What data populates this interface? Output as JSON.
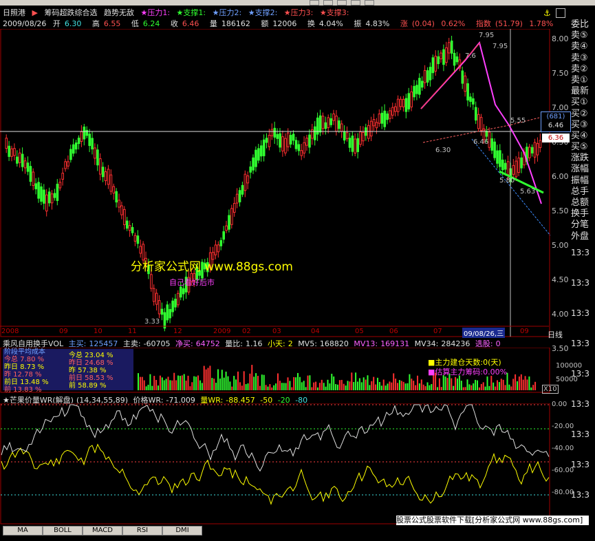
{
  "header": {
    "stock_name": "日照港",
    "menu_items": [
      "筹码超跌综合选",
      "趋势无敌"
    ],
    "indicators": [
      {
        "label": "★压力1:",
        "color": "#ff40ff"
      },
      {
        "label": "★支撑1:",
        "color": "#30ff30"
      },
      {
        "label": "★压力2:",
        "color": "#6fa0ff"
      },
      {
        "label": "★支撑2:",
        "color": "#6fa0ff"
      },
      {
        "label": "★压力3:",
        "color": "#ff5050"
      },
      {
        "label": "★支撑3:",
        "color": "#ff5050"
      }
    ],
    "date": "2009/08/26",
    "open_label": "开",
    "open": "6.30",
    "high_label": "高",
    "high": "6.55",
    "low_label": "低",
    "low": "6.24",
    "close_label": "收",
    "close": "6.46",
    "volume_label": "量",
    "volume": "186162",
    "amount_label": "额",
    "amount": "12006",
    "turnover_label": "换",
    "turnover": "4.04%",
    "amplitude_label": "振",
    "amplitude": "4.83%",
    "change_label": "涨",
    "change": "(0.04)",
    "change_pct": "0.62%",
    "index_label": "指数",
    "index_value": "(51.79)",
    "index_pct": "1.78%"
  },
  "right_panel": {
    "items": [
      "委比",
      "卖⑤",
      "卖④",
      "卖③",
      "卖②",
      "卖①",
      "最新",
      "买①",
      "买②",
      "买③",
      "买④",
      "买⑤",
      "涨跌",
      "涨幅",
      "振幅",
      "总手",
      "总额",
      "换手",
      "分笔",
      "外盘"
    ],
    "time_labels": [
      "13:3",
      "13:3",
      "13:3",
      "13:3",
      "13:3",
      "13:3",
      "13:3",
      "13:3",
      "13:3"
    ]
  },
  "price_axis": [
    "8.00",
    "7.50",
    "7.00",
    "6.50",
    "6.00",
    "5.50",
    "5.00",
    "4.50",
    "4.00",
    "3.50"
  ],
  "price_tags": {
    "bar_count": "(681)",
    "current": "6.46",
    "last": "6.36"
  },
  "chart_annotations": {
    "high_point": "7.95",
    "high_point2": "7.95",
    "point_7_6": "7.6",
    "mid_low": "6.30",
    "mid_low2": "6.46",
    "right_point": "5.55",
    "low_point": "5.80",
    "low_point2": "5.63",
    "bottom_low": "3.33"
  },
  "x_axis": [
    "2008",
    "09",
    "10",
    "11",
    "12",
    "2009",
    "02",
    "03",
    "04",
    "05",
    "06",
    "07",
    "09/08/26,三",
    "09"
  ],
  "x_axis_right_label": "日线",
  "watermark": "分析家公式网 www.88gs.com",
  "watermark2": "自己看好后市",
  "volume_panel": {
    "title": "乘风自用换手VOL",
    "main_buy_label": "主买:",
    "main_buy": "125457",
    "main_sell_label": "主卖:",
    "main_sell": "-60705",
    "net_buy_label": "净买:",
    "net_buy": "64752",
    "vol_ratio_label": "量比:",
    "vol_ratio": "1.16",
    "small_day_label": "小天:",
    "small_day": "2",
    "mv5_label": "MV5:",
    "mv5": "168820",
    "mv13_label": "MV13:",
    "mv13": "169131",
    "mv34_label": "MV34:",
    "mv34": "284236",
    "select_label": "选股:",
    "select": "0",
    "axis": [
      "100000",
      "50000"
    ],
    "scale": "X10",
    "left_legend": [
      "阶段平均成本",
      "今总 7.80 %",
      "昨日 8.73 %",
      "昨 12.78 %",
      "前日 13.48 %",
      "前 13.83 %"
    ],
    "mid_legend": [
      "今总 23.04 %",
      "昨日 24.68 %",
      "昨 57.38 %",
      "前日 58.53 %",
      "前 58.89 %"
    ],
    "right_legend": [
      "■主力建仓天数:0(天)",
      "■估算主力筹码:0.00%"
    ]
  },
  "wr_panel": {
    "title": "★芒果价量WR(解盘)",
    "params": "(14,34,55,89)",
    "price_wr_label": "价格WR:",
    "price_wr": "-71.009",
    "vol_wr_label": "量WR:",
    "vol_wr": "-88.457",
    "levels": [
      "-50",
      "-20",
      "-80"
    ],
    "axis": [
      "0.00",
      "-20.00",
      "-40.00",
      "-60.00",
      "-80.00"
    ]
  },
  "bottom_tabs": [
    "MA",
    "BOLL",
    "MACD",
    "RSI",
    "DMI"
  ],
  "footer_ad": "股票公式股票软件下载[分析家公式网 www.88gs.com]"
}
